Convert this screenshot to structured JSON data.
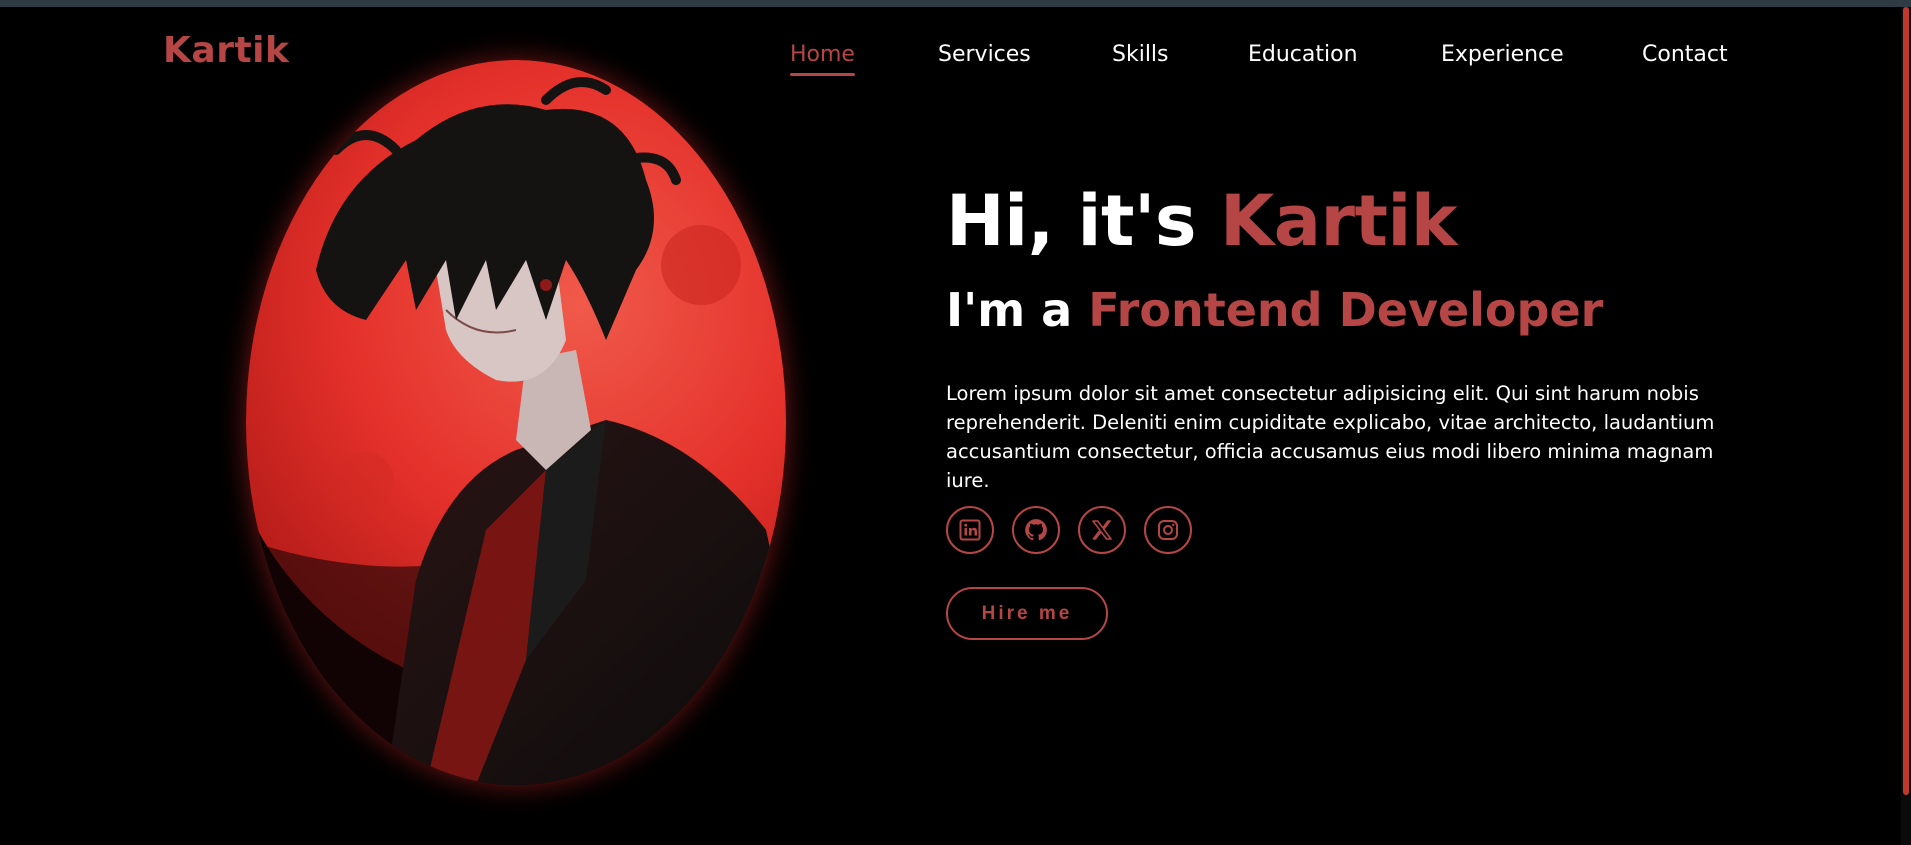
{
  "brand": {
    "logo_text": "Kartik"
  },
  "nav": {
    "items": [
      {
        "label": "Home",
        "active": true
      },
      {
        "label": "Services",
        "active": false
      },
      {
        "label": "Skills",
        "active": false
      },
      {
        "label": "Education",
        "active": false
      },
      {
        "label": "Experience",
        "active": false
      },
      {
        "label": "Contact",
        "active": false
      }
    ]
  },
  "hero": {
    "greeting_prefix": "Hi, it's ",
    "greeting_name": "Kartik",
    "role_prefix": "I'm a ",
    "role": "Frontend Developer",
    "description": "Lorem ipsum dolor sit amet consectetur adipisicing elit. Qui sint harum nobis reprehenderit. Deleniti enim cupiditate explicabo, vitae architecto, laudantium accusantium consectetur, officia accusamus eius modi libero minima magnam iure.",
    "cta_label": "Hire me"
  },
  "socials": [
    {
      "icon": "linkedin-icon"
    },
    {
      "icon": "github-icon"
    },
    {
      "icon": "x-icon"
    },
    {
      "icon": "instagram-icon"
    }
  ],
  "colors": {
    "accent": "#b64646",
    "background": "#000000",
    "text": "#ffffff",
    "moon": "#e8302a"
  }
}
